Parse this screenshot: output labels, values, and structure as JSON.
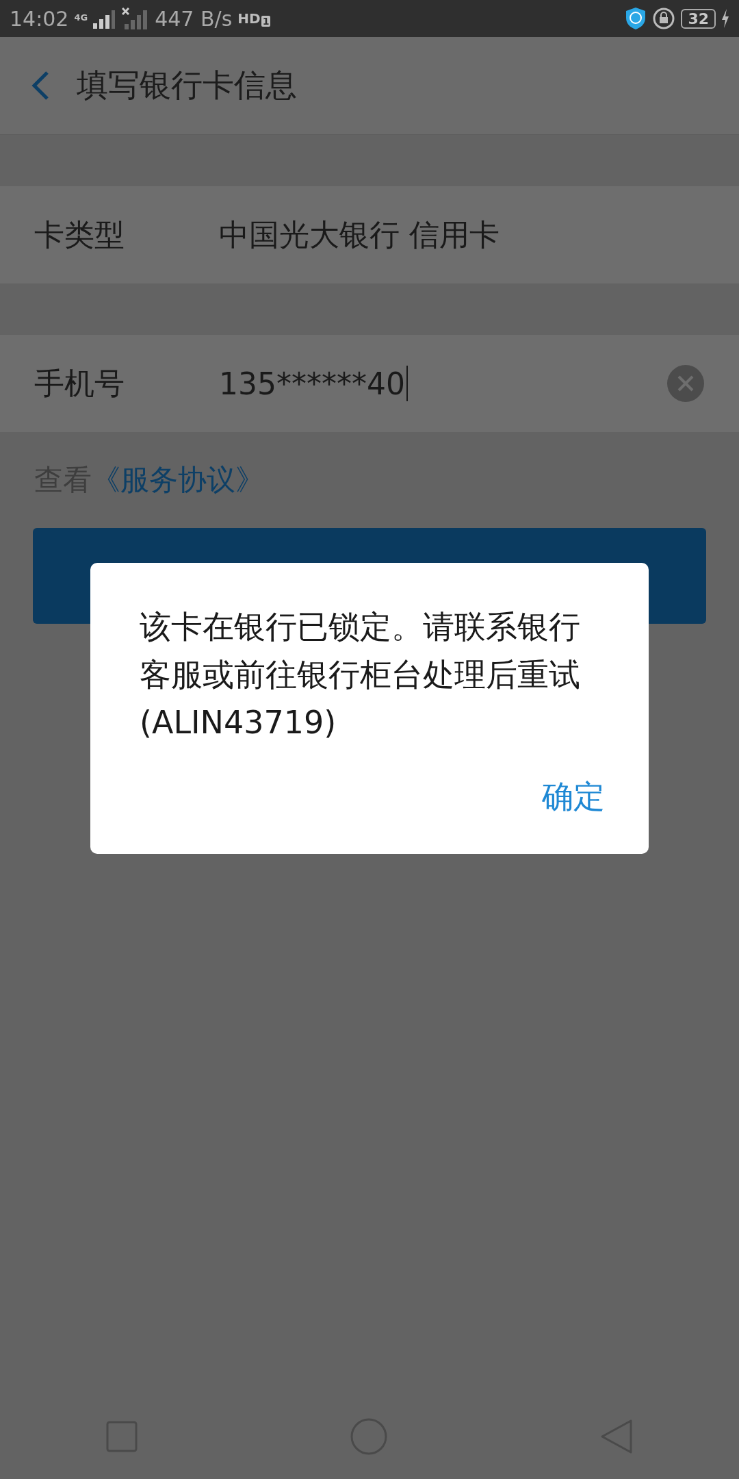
{
  "status_bar": {
    "time": "14:02",
    "network": "4G",
    "speed": "447 B/s",
    "hd": "HD",
    "hd_sim": "1",
    "battery": "32"
  },
  "app_bar": {
    "title": "填写银行卡信息"
  },
  "form": [
    {
      "kind": "static",
      "label": "卡类型",
      "value": "中国光大银行 信用卡"
    },
    {
      "kind": "input",
      "label": "手机号",
      "value": "135******40"
    }
  ],
  "agreement": {
    "prefix": "查看",
    "link": "《服务协议》"
  },
  "dialog": {
    "message": "该卡在银行已锁定。请联系银行客服或前往银行柜台处理后重试(ALIN43719)",
    "button": "确定"
  }
}
